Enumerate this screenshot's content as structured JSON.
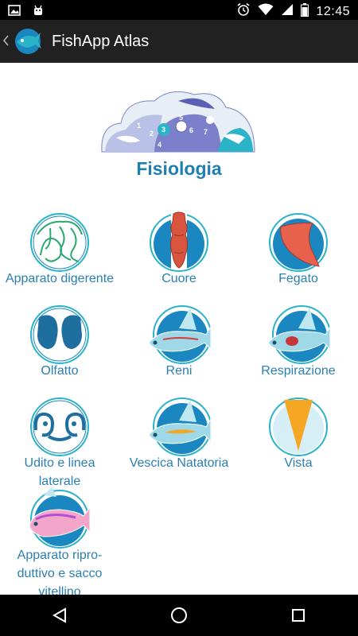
{
  "status_bar": {
    "time": "12:45",
    "left_icons": [
      "image-icon",
      "android-icon"
    ],
    "right_icons": [
      "alarm-icon",
      "wifi-icon",
      "signal-icon",
      "battery-icon"
    ]
  },
  "action_bar": {
    "back_icon": "chevron-left-icon",
    "logo_icon": "fish-logo-icon",
    "title": "FishApp Atlas"
  },
  "page": {
    "title": "Fisiologia",
    "header_numbers": [
      "1",
      "2",
      "3",
      "4",
      "5",
      "6",
      "7"
    ]
  },
  "tiles": [
    {
      "label": "Apparato digerente",
      "icon": "digestive-icon"
    },
    {
      "label": "Cuore",
      "icon": "heart-icon"
    },
    {
      "label": "Fegato",
      "icon": "liver-icon"
    },
    {
      "label": "Olfatto",
      "icon": "olfactory-icon"
    },
    {
      "label": "Reni",
      "icon": "kidney-fish-icon"
    },
    {
      "label": "Respirazione",
      "icon": "respiration-fish-icon"
    },
    {
      "label": "Udito e linea laterale",
      "icon": "ear-icon"
    },
    {
      "label": "Vescica Natatoria",
      "icon": "swim-bladder-fish-icon"
    },
    {
      "label": "Vista",
      "icon": "eye-icon"
    },
    {
      "label": "Apparato ripro-duttivo e sacco vitellino",
      "icon": "reproductive-fish-icon"
    }
  ],
  "colors": {
    "accent": "#1e7fb0",
    "label": "#2a7fb4",
    "action_bar": "#212121",
    "circle_blue": "#1b87c0",
    "circle_ring": "#2bb3c8"
  },
  "nav_bar": {
    "icons": [
      "back-triangle-icon",
      "home-circle-icon",
      "recents-square-icon"
    ]
  }
}
